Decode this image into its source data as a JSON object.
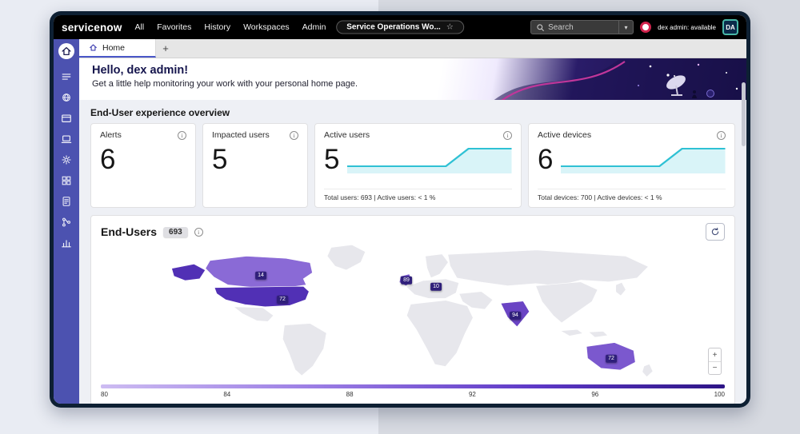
{
  "topbar": {
    "logo": "servicenow",
    "nav_items": [
      "All",
      "Favorites",
      "History",
      "Workspaces",
      "Admin"
    ],
    "workspace_switcher": "Service Operations Wo...",
    "search_placeholder": "Search",
    "presence": "dex admin: available",
    "avatar": "DA"
  },
  "icons": {
    "star_glyph": "☆",
    "caret_glyph": "▾",
    "info_glyph": "i",
    "add_tab_glyph": "+"
  },
  "sidebar": {
    "icon_names": [
      "home-icon",
      "list-icon",
      "globe-icon",
      "card-icon",
      "devices-icon",
      "settings-icon",
      "apps-grid-icon",
      "report-icon",
      "workflow-icon",
      "bar-chart-icon"
    ]
  },
  "tab_bar": {
    "active_tab": "Home"
  },
  "hero": {
    "title": "Hello, dex admin!",
    "subtitle": "Get a little help monitoring your work with your personal home page."
  },
  "overview": {
    "section_title": "End-User experience overview",
    "cards": [
      {
        "label": "Alerts",
        "value": "6"
      },
      {
        "label": "Impacted users",
        "value": "5"
      },
      {
        "label": "Active users",
        "value": "5",
        "footer": "Total users: 693 | Active users: < 1 %"
      },
      {
        "label": "Active devices",
        "value": "6",
        "footer": "Total devices: 700 | Active devices: < 1 %"
      }
    ]
  },
  "end_users": {
    "title": "End-Users",
    "badge": "693",
    "zoom_in": "+",
    "zoom_out": "−",
    "legend_ticks": [
      "80",
      "84",
      "88",
      "92",
      "96",
      "100"
    ],
    "country_labels": [
      {
        "country": "Canada",
        "value": "14"
      },
      {
        "country": "United States",
        "value": "72"
      },
      {
        "country": "United Kingdom",
        "value": "89"
      },
      {
        "country": "Germany",
        "value": "10"
      },
      {
        "country": "India",
        "value": "94"
      },
      {
        "country": "Australia",
        "value": "72"
      }
    ]
  },
  "colors": {
    "rail": "#4c52b0",
    "sparkline": "#2fc1d4",
    "choropleth_dark": "#2d1586",
    "choropleth_light": "#cdbcf2",
    "status_red": "#d1244d"
  },
  "chart_data": [
    {
      "type": "area",
      "title": "Active users sparkline",
      "values": [
        5,
        5,
        5,
        5,
        5,
        5,
        28,
        30,
        30
      ],
      "color": "#2fc1d4"
    },
    {
      "type": "area",
      "title": "Active devices sparkline",
      "values": [
        6,
        6,
        6,
        6,
        6,
        6,
        30,
        32,
        32
      ],
      "color": "#2fc1d4"
    },
    {
      "type": "heatmap",
      "title": "End-Users choropleth map",
      "legend_range": [
        80,
        100
      ],
      "legend_ticks": [
        80,
        84,
        88,
        92,
        96,
        100
      ],
      "countries": [
        {
          "name": "Canada",
          "label": "14"
        },
        {
          "name": "United States",
          "label": "72"
        },
        {
          "name": "United Kingdom",
          "label": "89"
        },
        {
          "name": "Germany",
          "label": "10"
        },
        {
          "name": "India",
          "label": "94"
        },
        {
          "name": "Australia",
          "label": "72"
        }
      ]
    }
  ]
}
